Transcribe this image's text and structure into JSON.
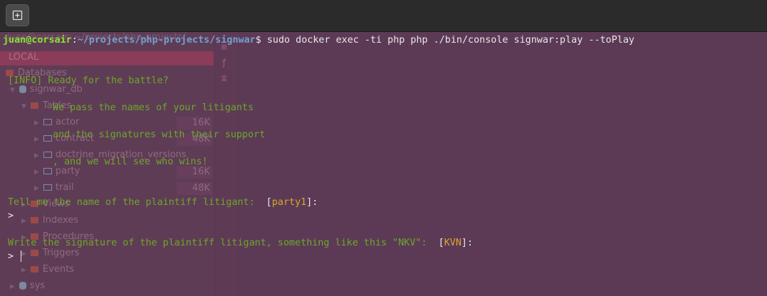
{
  "prompt": {
    "user_host": "juan@corsair",
    "separator": ":",
    "path": "~/projects/php-projects/signwar",
    "dollar": "$",
    "command": " sudo docker exec -ti php php ./bin/console signwar:play --toPlay"
  },
  "output": {
    "info_line": "[INFO] Ready for the battle?",
    "msg1": "We pass the names of your litigants",
    "msg2": "and the signatures with their support",
    "msg3": ", and we will see who wins!",
    "q1_text": "Tell me the name of the plaintiff litigant:  ",
    "q1_open": "[",
    "q1_default": "party1",
    "q1_close": "]:",
    "prompt1": ">",
    "q2_text": "Write the signature of the plaintiff litigant, something like this \"NKV\":  ",
    "q2_open": "[",
    "q2_default": "KVN",
    "q2_close": "]:",
    "prompt2": "> "
  },
  "background_browser": {
    "top_text": "juan@corsair: ~/projects/php-projects/...",
    "header": "LOCAL",
    "items": [
      {
        "label": "Databases"
      },
      {
        "label": "signwar_db"
      },
      {
        "label": "Tables"
      },
      {
        "label": "actor",
        "size": "16K"
      },
      {
        "label": "contract",
        "size": "48K"
      },
      {
        "label": "doctrine_migration_versions",
        "size": ""
      },
      {
        "label": "party",
        "size": "16K"
      },
      {
        "label": "trail",
        "size": "48K"
      },
      {
        "label": "Views"
      },
      {
        "label": "Indexes"
      },
      {
        "label": "Procedures"
      },
      {
        "label": "Triggers"
      },
      {
        "label": "Events"
      },
      {
        "label": "sys"
      }
    ]
  },
  "colors": {
    "background": "#5c3a56",
    "user": "#8ae234",
    "path": "#729fcf",
    "green_text": "#6ca828",
    "orange_text": "#d8a82a"
  }
}
